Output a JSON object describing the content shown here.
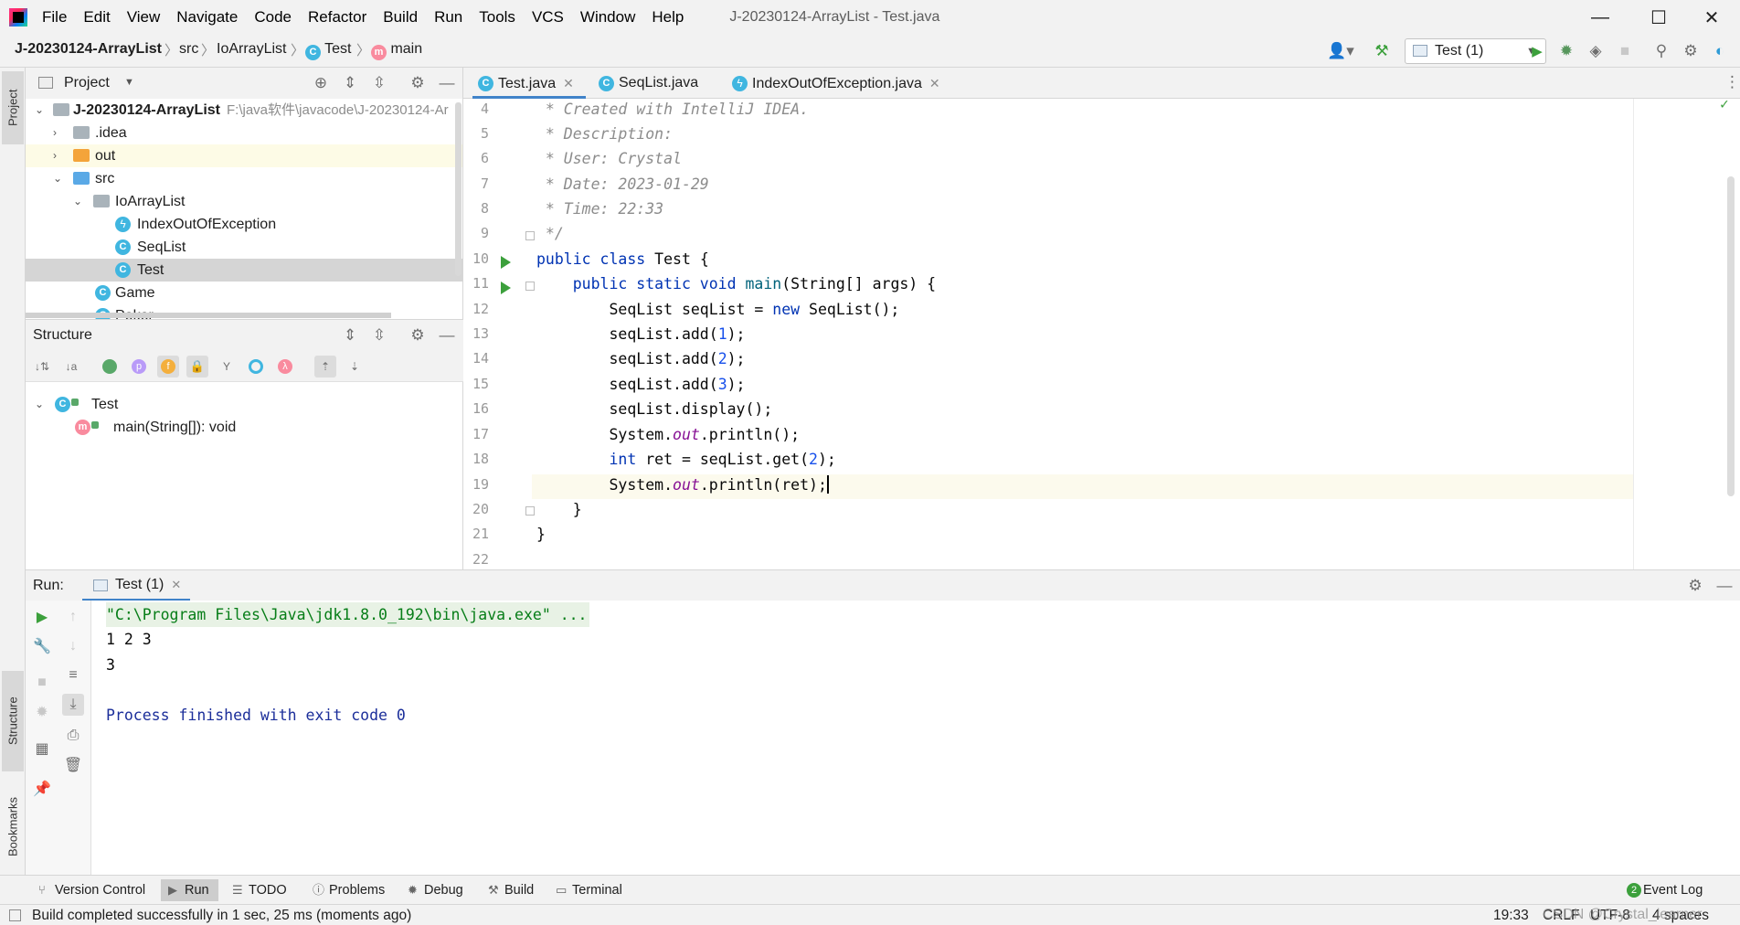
{
  "window": {
    "title": "J-20230124-ArrayList - Test.java",
    "menu": [
      "File",
      "Edit",
      "View",
      "Navigate",
      "Code",
      "Refactor",
      "Build",
      "Run",
      "Tools",
      "VCS",
      "Window",
      "Help"
    ]
  },
  "navbar": {
    "project": "J-20230124-ArrayList",
    "src": "src",
    "package": "IoArrayList",
    "class": "Test",
    "method": "main",
    "run_config": "Test (1)"
  },
  "left_stripe": {
    "project": "Project",
    "structure": "Structure",
    "bookmarks": "Bookmarks"
  },
  "project_panel": {
    "title": "Project",
    "tree": [
      {
        "label": "J-20230124-ArrayList",
        "path": "F:\\java软件\\javacode\\J-20230124-Ar"
      },
      {
        "label": ".idea"
      },
      {
        "label": "out"
      },
      {
        "label": "src"
      },
      {
        "label": "IoArrayList"
      },
      {
        "label": "IndexOutOfException"
      },
      {
        "label": "SeqList"
      },
      {
        "label": "Test"
      },
      {
        "label": "Game"
      },
      {
        "label": "Poker"
      }
    ]
  },
  "structure_panel": {
    "title": "Structure",
    "tree": [
      {
        "label": "Test"
      },
      {
        "label": "main(String[]): void"
      }
    ]
  },
  "editor": {
    "tabs": [
      {
        "label": "Test.java",
        "active": true
      },
      {
        "label": "SeqList.java",
        "active": false
      },
      {
        "label": "IndexOutOfException.java",
        "active": false
      }
    ],
    "line_numbers": [
      "4",
      "5",
      "6",
      "7",
      "8",
      "9",
      "10",
      "11",
      "12",
      "13",
      "14",
      "15",
      "16",
      "17",
      "18",
      "19",
      "20",
      "21",
      "22"
    ],
    "code": {
      "l4": " * Created with IntelliJ IDEA.",
      "l5": " * Description:",
      "l6": " * User: Crystal",
      "l7": " * Date: 2023-01-29",
      "l8": " * Time: 22:33",
      "l9": " */",
      "l10_kw": "public class",
      "l10_rest": " Test {",
      "l11_kw": "    public static void",
      "l11_fn": "main",
      "l11_rest": "(String[] args) {",
      "l12_a": "        SeqList seqList = ",
      "l12_kw": "new",
      "l12_b": " SeqList();",
      "l13_a": "        seqList.add(",
      "l13_n": "1",
      "l14_n": "2",
      "l15_n": "3",
      "l_close": ");",
      "l16": "        seqList.display();",
      "l17_a": "        System.",
      "l_out": "out",
      "l17_b": ".println();",
      "l18_kw": "        int",
      "l18_a": " ret = seqList.get(",
      "l18_n": "2",
      "l19_b": ".println(ret);",
      "l20": "    }",
      "l21": "}"
    }
  },
  "run_panel": {
    "label": "Run:",
    "tab": "Test (1)",
    "console": [
      "\"C:\\Program Files\\Java\\jdk1.8.0_192\\bin\\java.exe\" ...",
      "1 2 3",
      "3",
      "",
      "Process finished with exit code 0"
    ]
  },
  "bottom_tabs": [
    {
      "label": "Version Control",
      "icon": "branch-icon"
    },
    {
      "label": "Run",
      "icon": "play-icon"
    },
    {
      "label": "TODO",
      "icon": "list-icon"
    },
    {
      "label": "Problems",
      "icon": "info-icon"
    },
    {
      "label": "Debug",
      "icon": "bug-icon"
    },
    {
      "label": "Build",
      "icon": "hammer-icon"
    },
    {
      "label": "Terminal",
      "icon": "terminal-icon"
    },
    {
      "label": "Event Log",
      "icon": "event-log-icon",
      "badge": "2"
    }
  ],
  "statusbar": {
    "message": "Build completed successfully in 1 sec, 25 ms (moments ago)",
    "position": "19:33",
    "line_sep": "CRLF",
    "encoding": "UTF-8",
    "indent": "4 spaces",
    "watermark": "CSDN @Crystal_learner"
  },
  "colors": {
    "keyword": "#0033b3",
    "comment": "#8c8c8c",
    "number": "#1750eb",
    "static_field": "#871094",
    "console_path_bg": "#e8f2e5",
    "console_finish": "#1b2e9a",
    "run_green": "#3ca03c"
  }
}
